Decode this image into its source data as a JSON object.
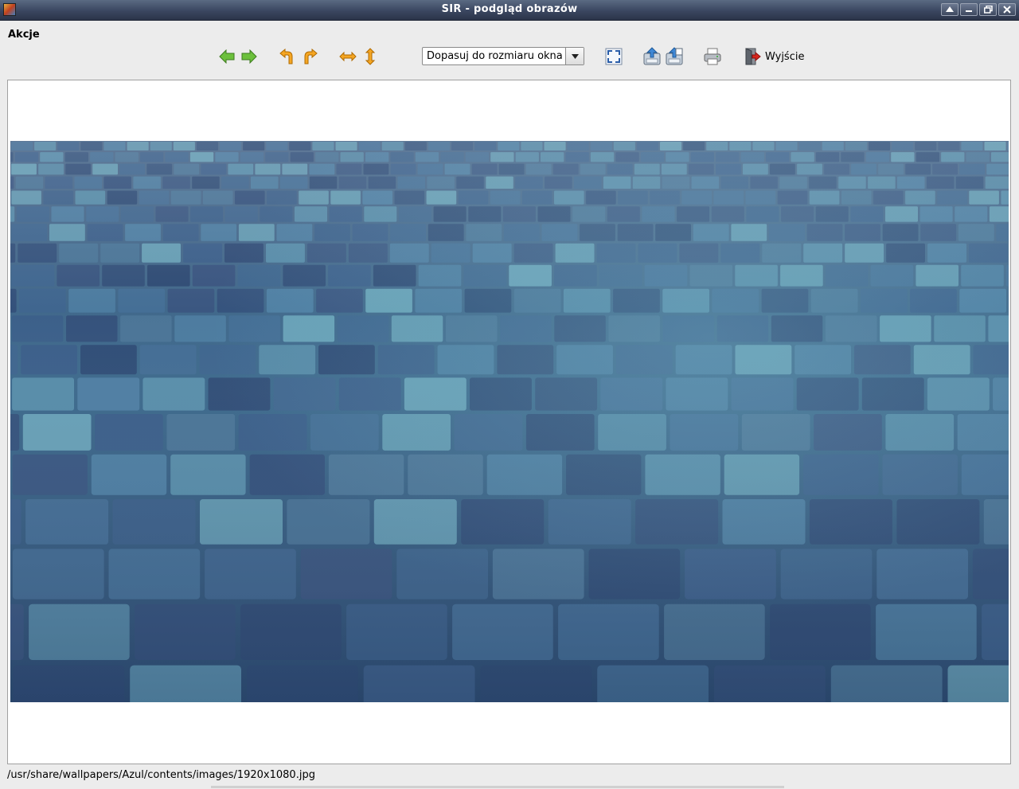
{
  "window": {
    "title": "SIR - podgląd obrazów",
    "buttons": [
      "maximize-up",
      "minimize",
      "restore",
      "close"
    ]
  },
  "menu": {
    "actions_label": "Akcje"
  },
  "toolbar": {
    "zoom_value": "Dopasuj do rozmiaru okna",
    "exit_label": "Wyjście"
  },
  "status": {
    "file_path": "/usr/share/wallpapers/Azul/contents/images/1920x1080.jpg"
  },
  "image": {
    "description_icon": "blue-tiles-photo",
    "accent": "#3f6d95"
  }
}
